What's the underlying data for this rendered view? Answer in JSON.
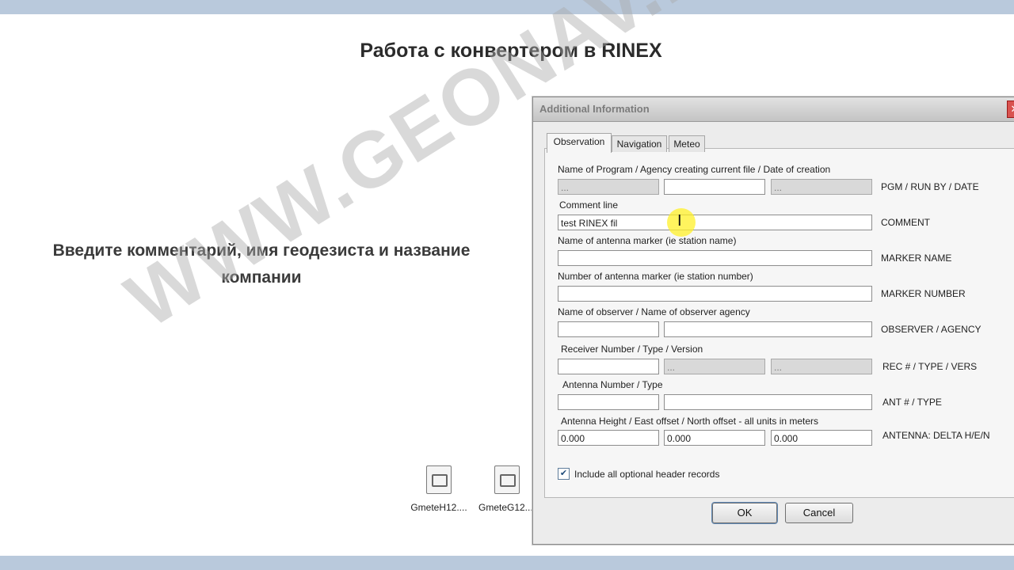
{
  "slide": {
    "title": "Работа с конвертером в RINEX",
    "instruction_line1": "Введите комментарий, имя геодезиста и название",
    "instruction_line2": "компании"
  },
  "desktop": {
    "files": [
      {
        "name": "GmeteH12....",
        "icon": "document-icon"
      },
      {
        "name": "GmeteG12....",
        "icon": "document-icon"
      }
    ]
  },
  "dialog": {
    "title": "Additional Information",
    "tabs": [
      "Observation",
      "Navigation",
      "Meteo"
    ],
    "sections": {
      "pgm": {
        "label": "Name of Program / Agency creating current file / Date of creation",
        "values": [
          "...",
          "",
          "..."
        ],
        "right": "PGM / RUN BY / DATE"
      },
      "comment": {
        "label": "Comment line",
        "value": "test RINEX fil",
        "right": "COMMENT"
      },
      "marker_name": {
        "label": "Name of antenna marker (ie station name)",
        "value": "",
        "right": "MARKER NAME"
      },
      "marker_number": {
        "label": "Number of antenna marker (ie station number)",
        "value": "",
        "right": "MARKER NUMBER"
      },
      "observer": {
        "label": "Name of observer / Name of observer agency",
        "values": [
          "",
          ""
        ],
        "right": "OBSERVER / AGENCY"
      },
      "receiver": {
        "label": "Receiver Number / Type / Version",
        "values": [
          "",
          "...",
          "..."
        ],
        "right": "REC # / TYPE / VERS"
      },
      "antenna": {
        "label": "Antenna Number / Type",
        "values": [
          "",
          ""
        ],
        "right": "ANT # / TYPE"
      },
      "delta": {
        "label": "Antenna Height / East offset / North offset - all units in meters",
        "values": [
          "0.000",
          "0.000",
          "0.000"
        ],
        "right": "ANTENNA: DELTA H/E/N"
      }
    },
    "include_optional": {
      "label": "Include all optional header records",
      "checked": true
    },
    "buttons": {
      "ok": "OK",
      "cancel": "Cancel"
    }
  },
  "watermark": "WWW.GEONAV.RU"
}
